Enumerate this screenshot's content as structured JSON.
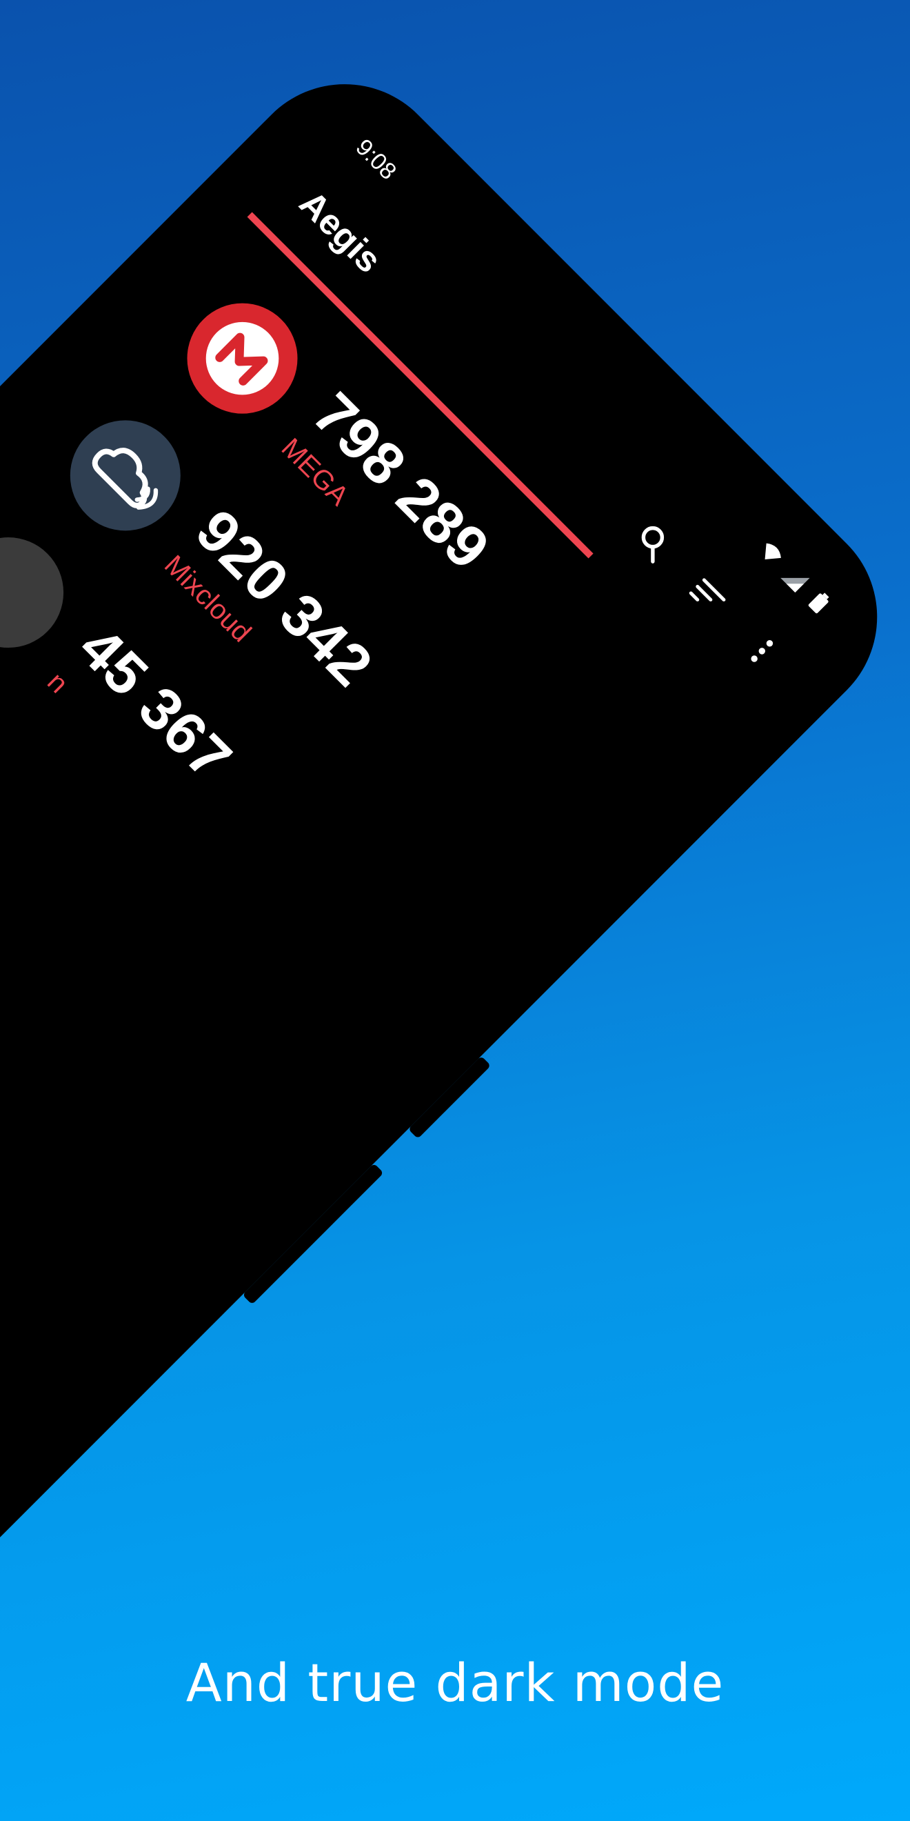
{
  "status_bar": {
    "time": "9:08",
    "icons": [
      "wifi-icon",
      "signal-icon",
      "battery-icon"
    ]
  },
  "app_bar": {
    "title": "Aegis",
    "actions": [
      "search-icon",
      "sort-icon",
      "more-vert-icon"
    ]
  },
  "colors": {
    "accent": "#ee4550",
    "background": "#000000",
    "text": "#ffffff",
    "gradient_top": "#0a52ad",
    "gradient_bottom": "#00a9fb",
    "mixcloud_icon_bg": "#2f3f52"
  },
  "entries": [
    {
      "code": "798 289",
      "issuer": "MEGA",
      "icon": "mega-logo-icon"
    },
    {
      "code": "920 342",
      "issuer": "Mixcloud",
      "icon": "mixcloud-logo-icon"
    },
    {
      "code": "45 367",
      "issuer": "n",
      "icon": "generic-icon"
    }
  ],
  "caption": "And true dark mode"
}
